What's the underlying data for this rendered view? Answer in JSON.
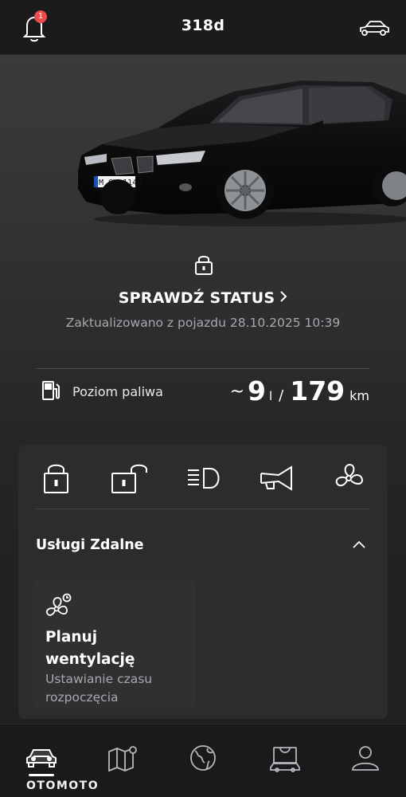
{
  "header": {
    "title": "318d",
    "notification_count": "1"
  },
  "vehicle": {
    "plate": "M CV 1144"
  },
  "status": {
    "link_label": "SPRAWDŹ STATUS",
    "updated_text": "Zaktualizowano z pojazdu 28.10.2025 10:39"
  },
  "fuel": {
    "label": "Poziom paliwa",
    "approx": "~",
    "liters": "9",
    "liters_unit": "l",
    "separator": "/",
    "range": "179",
    "range_unit": "km"
  },
  "quick_actions": [
    {
      "icon": "lock-icon"
    },
    {
      "icon": "unlock-icon"
    },
    {
      "icon": "headlight-icon"
    },
    {
      "icon": "horn-icon"
    },
    {
      "icon": "fan-icon"
    }
  ],
  "remote_services": {
    "title": "Usługi Zdalne",
    "card": {
      "title": "Planuj wentylację",
      "subtitle": "Ustawianie czasu rozpoczęcia"
    }
  },
  "bottom_nav": [
    {
      "icon": "car-icon",
      "active": true
    },
    {
      "icon": "map-icon"
    },
    {
      "icon": "globe-icon"
    },
    {
      "icon": "shop-icon"
    },
    {
      "icon": "profile-icon"
    }
  ],
  "watermark": "OTOMOTO",
  "colors": {
    "badge": "#e84c4c",
    "background": "#202123",
    "panel": "#2b2c2e"
  }
}
